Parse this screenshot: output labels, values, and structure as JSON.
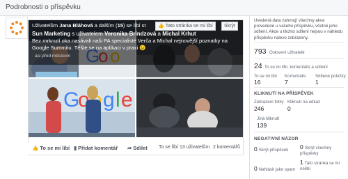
{
  "dialog": {
    "title": "Podrobnosti o příspěvku"
  },
  "post": {
    "top_users": "Jana Bláhová",
    "top_mid": " a dalším (",
    "top_count": "15",
    "top_end": ") se líbí st",
    "like_page_label": "Tato stránka se mi líbí",
    "close_label": "Skrýt",
    "author": "Sun Marketing",
    "with_text": " s uživatelem ",
    "person1": "Veronika Brindzová",
    "and_text": " a ",
    "person2": "Michal Krhut",
    "message": "Bez mrknutí oka nasávali naši PA specialisté Verča a Michal nejnovější poznatky na Google Summitu. Těšte se na aplikaci v praxi 😉",
    "time": "asi před měsícem"
  },
  "actions": {
    "like": "To se mi líbí",
    "comment": "Přidat komentář",
    "share": "Sdílet",
    "likes_stat": "To se líbí 13 uživatelům",
    "comments_stat": "2 komentářů"
  },
  "insights": {
    "note": "Uvedená data zahrnují všechny akce provedené u vašeho příspěvku, včetně jeho sdílení. Akce u těchto sdílení nejsou v náhledu příspěvku nalevo zobrazeny.",
    "reach_value": "793",
    "reach_label": "Oslovení uživatelé",
    "engage_value": "24",
    "engage_label": "To se mi líbí, komentáře a sdílení",
    "likes_label": "To se mi líbí",
    "likes_value": "16",
    "comments_label": "Komentáře",
    "comments_value": "7",
    "shares_label": "Sdílené položky",
    "shares_value": "1",
    "clicks_head": "KLIKNUTÍ NA PŘÍSPĚVEK",
    "photo_views_label": "Zobrazení fotky",
    "photo_views_value": "246",
    "link_clicks_label": "Kliknutí na odkaz",
    "link_clicks_value": "0",
    "other_clicks_label": "Jiná kliknutí",
    "other_clicks_value": "139",
    "negative_head": "NEGATIVNÍ NÁZOR",
    "hide_post_value": "0",
    "hide_post_label": "Skrýt příspěvek",
    "hide_all_value": "0",
    "hide_all_label": "Skrýt všechny příspěvky",
    "spam_value": "0",
    "spam_label": "Nahlásit jako spam",
    "unlike_value": "1",
    "unlike_label": "Tato stránka se mi nelíbí"
  },
  "colors": {
    "accent": "#4267b2",
    "text": "#1d2129",
    "muted": "#606770",
    "google_blue": "#4285f4",
    "google_red": "#ea4335",
    "google_yellow": "#fbbc05",
    "google_green": "#34a853"
  },
  "icons": {
    "avatar": "sun-logo",
    "like": "thumbs-up-icon",
    "comment": "comment-icon",
    "share": "share-icon"
  }
}
